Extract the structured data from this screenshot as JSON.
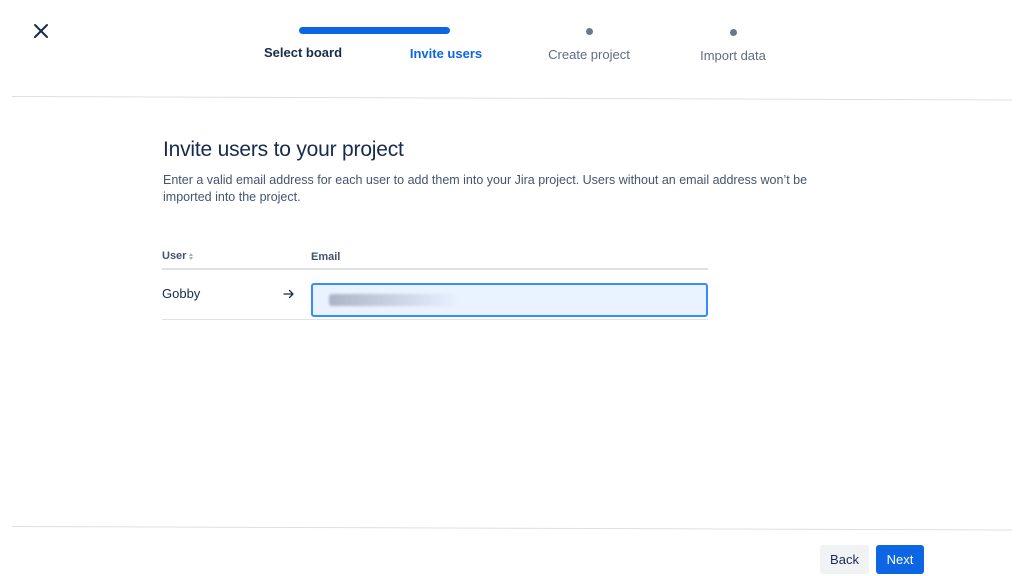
{
  "stepper": {
    "steps": [
      {
        "label": "Select board",
        "state": "complete"
      },
      {
        "label": "Invite users",
        "state": "current"
      },
      {
        "label": "Create project",
        "state": "upcoming"
      },
      {
        "label": "Import data",
        "state": "upcoming"
      }
    ]
  },
  "main": {
    "title": "Invite users to your project",
    "description": "Enter a valid email address for each user to add them into your Jira project. Users without an email address won’t be imported into the project."
  },
  "table": {
    "headers": {
      "user": "User",
      "email": "Email"
    },
    "rows": [
      {
        "user": "Gobby",
        "email": ""
      }
    ]
  },
  "footer": {
    "back_label": "Back",
    "next_label": "Next"
  },
  "icons": {
    "close": "close-icon",
    "sort": "sort-icon",
    "arrow": "arrow-right-icon"
  },
  "colors": {
    "accent": "#0c66e4",
    "text": "#172b4d",
    "input_bg": "#e9f2ff",
    "input_border": "#388bff"
  }
}
